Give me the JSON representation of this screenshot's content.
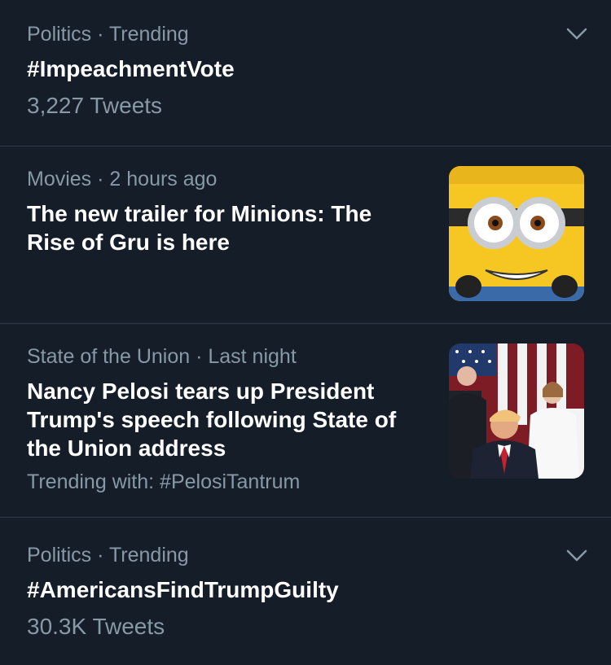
{
  "trends": [
    {
      "category": "Politics",
      "context": "Trending",
      "title": "#ImpeachmentVote",
      "count": "3,227 Tweets",
      "menu_icon": "chevron-down-icon"
    },
    {
      "category": "Movies",
      "context": "2 hours ago",
      "title_line1": "The new trailer for Minions: The",
      "title_line2": "Rise of Gru is here",
      "thumbnail_icon": "minion-thumbnail"
    },
    {
      "category": "State of the Union",
      "context": "Last night",
      "title_line1": "Nancy Pelosi tears up President",
      "title_line2": "Trump's speech following State of",
      "title_line3": "the Union address",
      "trending_with": "Trending with: #PelosiTantrum",
      "thumbnail_icon": "state-of-union-thumbnail"
    },
    {
      "category": "Politics",
      "context": "Trending",
      "title": "#AmericansFindTrumpGuilty",
      "count": "30.3K Tweets",
      "menu_icon": "chevron-down-icon"
    }
  ],
  "separator": " · ",
  "colors": {
    "background": "#151d29",
    "secondary_text": "#8899a6",
    "divider": "#2f3a49",
    "primary_text": "#ffffff"
  }
}
